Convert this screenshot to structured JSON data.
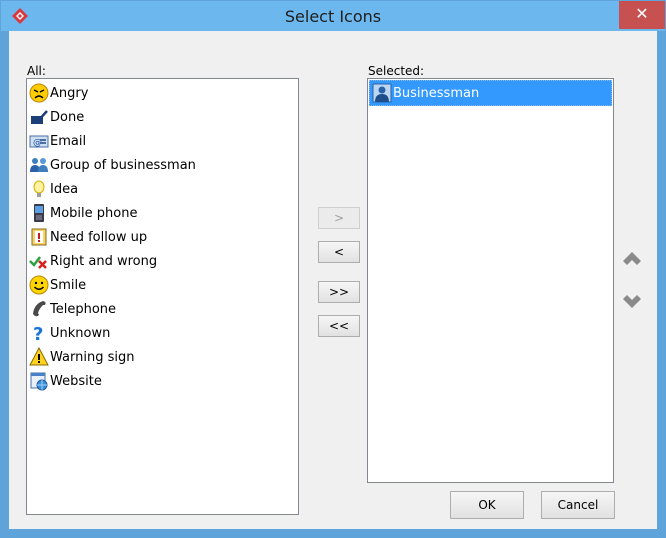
{
  "window": {
    "title": "Select Icons",
    "close_label": "✕"
  },
  "all_list": {
    "label": "All:",
    "items": [
      {
        "label": "Angry",
        "icon": "angry-icon"
      },
      {
        "label": "Done",
        "icon": "checkmark-icon"
      },
      {
        "label": "Email",
        "icon": "email-icon"
      },
      {
        "label": "Group of businessman",
        "icon": "group-icon"
      },
      {
        "label": "Idea",
        "icon": "lightbulb-icon"
      },
      {
        "label": "Mobile phone",
        "icon": "mobile-phone-icon"
      },
      {
        "label": "Need follow up",
        "icon": "follow-up-icon"
      },
      {
        "label": "Right and wrong",
        "icon": "right-wrong-icon"
      },
      {
        "label": "Smile",
        "icon": "smile-icon"
      },
      {
        "label": "Telephone",
        "icon": "telephone-icon"
      },
      {
        "label": "Unknown",
        "icon": "question-icon"
      },
      {
        "label": "Warning sign",
        "icon": "warning-icon"
      },
      {
        "label": "Website",
        "icon": "website-icon"
      }
    ]
  },
  "selected_list": {
    "label": "Selected:",
    "items": [
      {
        "label": "Businessman",
        "icon": "businessman-icon",
        "selected": true
      }
    ]
  },
  "transfer_buttons": {
    "add": ">",
    "remove": "<",
    "add_all": ">>",
    "remove_all": "<<"
  },
  "footer": {
    "ok": "OK",
    "cancel": "Cancel"
  },
  "colors": {
    "title_bar": "#6cb8ee",
    "close": "#c75050",
    "selection": "#3399ff",
    "arrows": "#8a8a8a"
  }
}
